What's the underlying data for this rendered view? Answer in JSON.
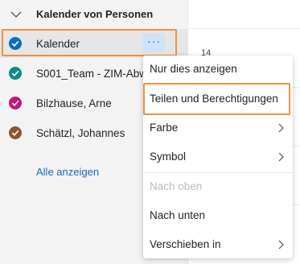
{
  "sidebar": {
    "group_title": "Kalender von Personen",
    "calendars": [
      {
        "label": "Kalender",
        "color": "#0f6cbd",
        "selected": true,
        "icon": "check-circle-icon"
      },
      {
        "label": "S001_Team - ZIM-Abw",
        "color": "#0e8a86",
        "selected": false,
        "icon": "check-circle-icon"
      },
      {
        "label": "Bilzhause, Arne",
        "color": "#c0167c",
        "selected": false,
        "icon": "check-circle-icon"
      },
      {
        "label": "Schätzl, Johannes",
        "color": "#8e562e",
        "selected": false,
        "icon": "check-circle-icon"
      }
    ],
    "more_button_icon": "ellipsis-icon",
    "more_button_text": "···",
    "show_all": "Alle anzeigen"
  },
  "calendar_view": {
    "day_number": "14"
  },
  "context_menu": {
    "items": [
      {
        "label": "Nur dies anzeigen",
        "submenu": false,
        "disabled": false
      },
      {
        "label": "Teilen und Berechtigungen",
        "submenu": false,
        "disabled": false,
        "highlighted": true
      },
      {
        "label": "Farbe",
        "submenu": true,
        "disabled": false
      },
      {
        "label": "Symbol",
        "submenu": true,
        "disabled": false
      },
      {
        "label": "Nach oben",
        "submenu": false,
        "disabled": true
      },
      {
        "label": "Nach unten",
        "submenu": false,
        "disabled": false
      },
      {
        "label": "Verschieben in",
        "submenu": true,
        "disabled": false
      }
    ]
  },
  "colors": {
    "highlight_outline": "#f0913c",
    "link": "#0f6cbd",
    "more_button_bg": "#cfe4fa"
  }
}
